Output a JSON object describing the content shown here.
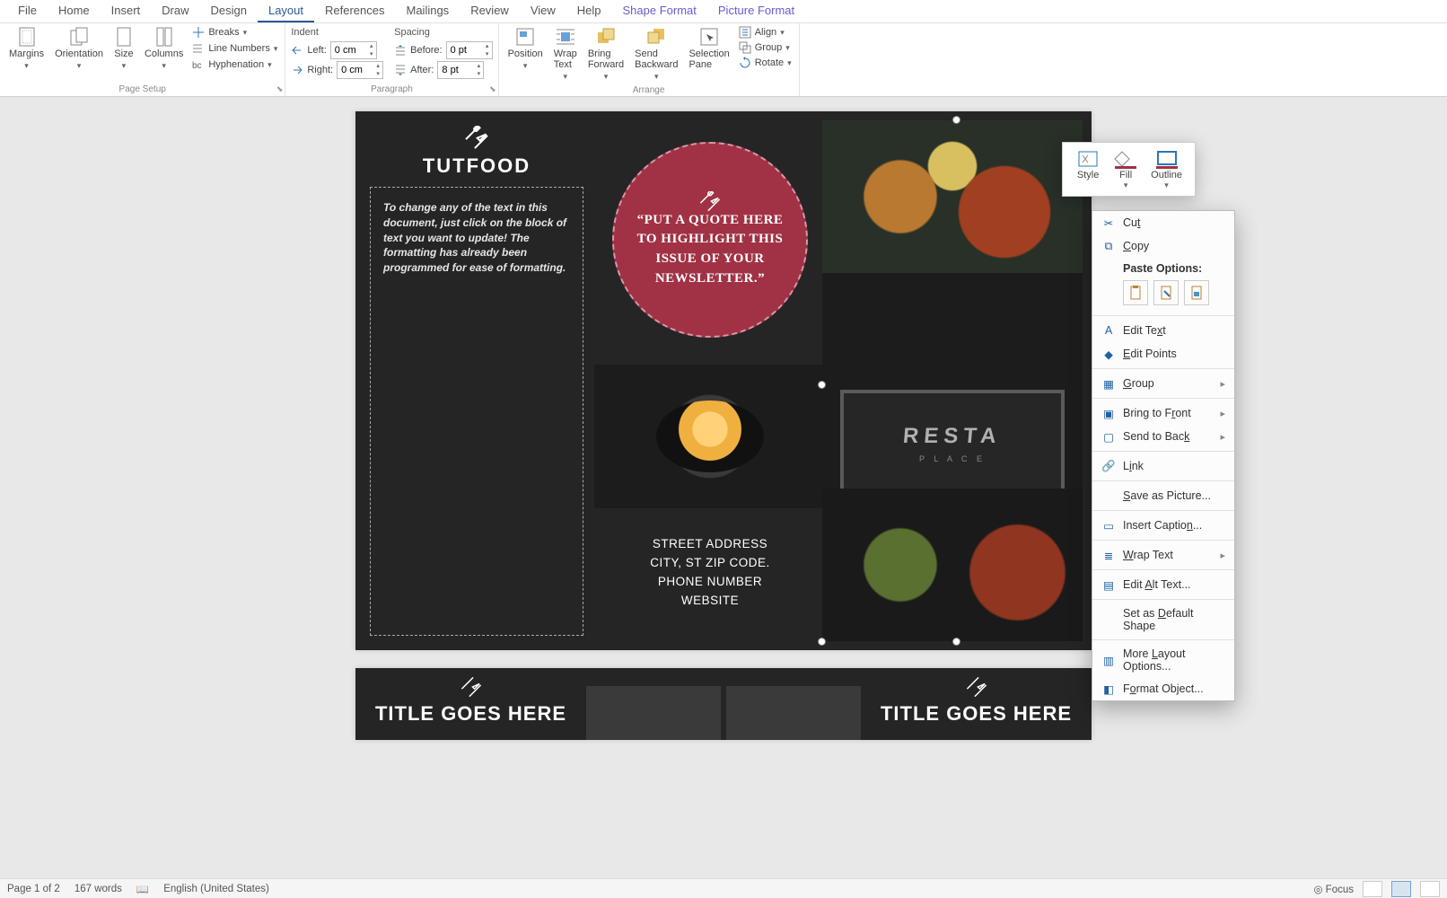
{
  "tabs": {
    "file": "File",
    "home": "Home",
    "insert": "Insert",
    "draw": "Draw",
    "design": "Design",
    "layout": "Layout",
    "references": "References",
    "mailings": "Mailings",
    "review": "Review",
    "view": "View",
    "help": "Help",
    "shape_format": "Shape Format",
    "picture_format": "Picture Format"
  },
  "ribbon": {
    "page_setup": {
      "margins": "Margins",
      "orientation": "Orientation",
      "size": "Size",
      "columns": "Columns",
      "breaks": "Breaks",
      "line_numbers": "Line Numbers",
      "hyphenation": "Hyphenation",
      "group_label": "Page Setup"
    },
    "paragraph": {
      "indent_label": "Indent",
      "left_label": "Left:",
      "right_label": "Right:",
      "left_value": "0 cm",
      "right_value": "0 cm",
      "spacing_label": "Spacing",
      "before_label": "Before:",
      "after_label": "After:",
      "before_value": "0 pt",
      "after_value": "8 pt",
      "group_label": "Paragraph"
    },
    "arrange": {
      "position": "Position",
      "wrap_text": "Wrap\nText",
      "bring_forward": "Bring\nForward",
      "send_backward": "Send\nBackward",
      "selection_pane": "Selection\nPane",
      "align": "Align",
      "group": "Group",
      "rotate": "Rotate",
      "group_label": "Arrange"
    }
  },
  "mini_toolbar": {
    "style": "Style",
    "fill": "Fill",
    "outline": "Outline"
  },
  "context_menu": {
    "cut": "Cut",
    "copy": "Copy",
    "paste_options": "Paste Options:",
    "edit_text": "Edit Text",
    "edit_points": "Edit Points",
    "group": "Group",
    "bring_to_front": "Bring to Front",
    "send_to_back": "Send to Back",
    "link": "Link",
    "save_as_picture": "Save as Picture...",
    "insert_caption": "Insert Caption...",
    "wrap_text": "Wrap Text",
    "edit_alt_text": "Edit Alt Text...",
    "set_as_default": "Set as Default Shape",
    "more_layout": "More Layout Options...",
    "format_object": "Format Object..."
  },
  "doc": {
    "brand": "TUTFOOD",
    "para": "To change any of the text in this document, just click on the block of text you want to update!  The formatting has already been programmed for ease of formatting.",
    "quote": "“PUT A QUOTE HERE TO HIGHLIGHT THIS ISSUE OF YOUR NEWSLETTER.”",
    "addr1": "STREET ADDRESS",
    "addr2": "CITY, ST ZIP CODE.",
    "addr3": "PHONE NUMBER",
    "addr4": "WEBSITE",
    "restaurant": "RESTA",
    "rest_sub": "P L A C E",
    "p2_title_left": "TITLE GOES HERE",
    "p2_title_right": "TITLE GOES HERE"
  },
  "status": {
    "page": "Page 1 of 2",
    "words": "167 words",
    "lang": "English (United States)",
    "focus": "Focus"
  }
}
